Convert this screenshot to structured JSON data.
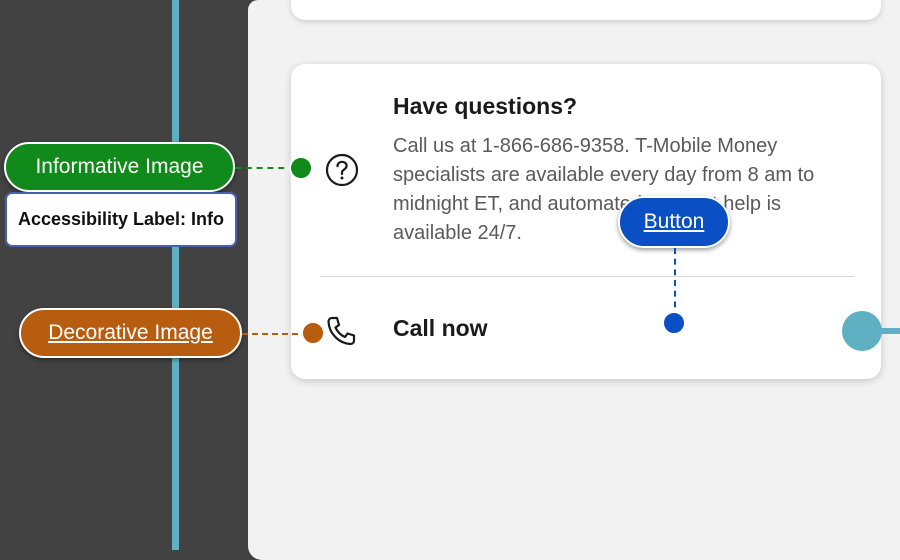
{
  "card": {
    "heading": "Have questions?",
    "body": "Call us at 1-866-686-9358. T-Mobile Money specialists are available every day from 8 am to midnight ET, and automated account help is available 24/7.",
    "call_label": "Call now",
    "help_icon": "question-circle-icon",
    "phone_icon": "phone-icon"
  },
  "annotations": {
    "informative": {
      "label": "Informative Image",
      "color": "#0f8a1b"
    },
    "accessibility_label": "Accessibility Label: Info",
    "decorative": {
      "label": "Decorative Image",
      "color": "#b85c10"
    },
    "button": {
      "label": "Button",
      "color": "#0b4fc4"
    }
  },
  "colors": {
    "background": "#424242",
    "panel": "#f2f2f2",
    "focus_line": "#5fb0c3"
  }
}
